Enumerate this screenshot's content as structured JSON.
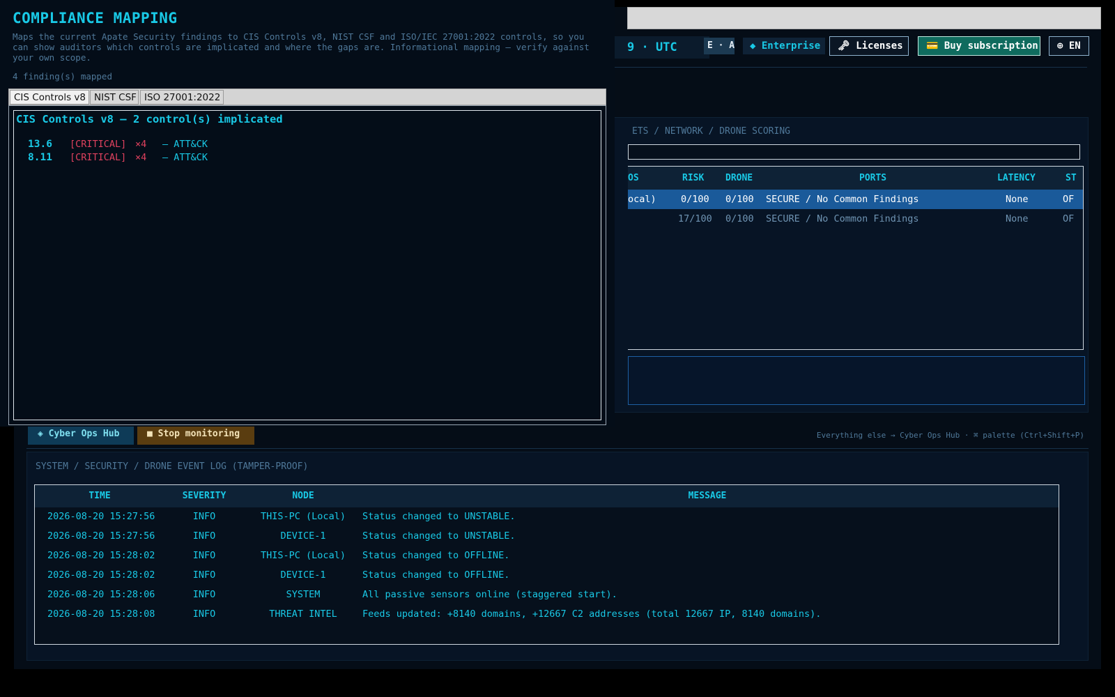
{
  "toolbar": {
    "clock": "9  ·  UTC",
    "mode": "E · AD",
    "edition": "◆ Enterprise",
    "licenses": "🗝 Licenses",
    "buy": "💳 Buy subscription",
    "language": "⊕ EN"
  },
  "assets": {
    "breadcrumb": "ETS / NETWORK / DRONE SCORING",
    "columns": [
      "OS",
      "RISK",
      "DRONE",
      "PORTS",
      "LATENCY",
      "ST"
    ],
    "rows": [
      {
        "name": "ocal)",
        "risk": "0/100",
        "drone": "0/100",
        "ports": "SECURE / No Common Findings",
        "latency": "None",
        "status": "OF"
      },
      {
        "name": "",
        "risk": "17/100",
        "drone": "0/100",
        "ports": "SECURE / No Common Findings",
        "latency": "None",
        "status": "OF"
      }
    ]
  },
  "actions": {
    "hub": "◈  Cyber Ops Hub",
    "stop": "■  Stop monitoring",
    "hint": "Everything else → Cyber Ops Hub  ·  ⌘ palette (Ctrl+Shift+P)"
  },
  "event_log": {
    "title": "SYSTEM / SECURITY / DRONE EVENT LOG (TAMPER-PROOF)",
    "columns": {
      "time": "TIME",
      "severity": "SEVERITY",
      "node": "NODE",
      "message": "MESSAGE"
    },
    "rows": [
      {
        "time": "2026-08-20 15:27:56",
        "severity": "INFO",
        "node": "THIS-PC (Local)",
        "message": "Status changed to UNSTABLE."
      },
      {
        "time": "2026-08-20 15:27:56",
        "severity": "INFO",
        "node": "DEVICE-1",
        "message": "Status changed to UNSTABLE."
      },
      {
        "time": "2026-08-20 15:28:02",
        "severity": "INFO",
        "node": "THIS-PC (Local)",
        "message": "Status changed to OFFLINE."
      },
      {
        "time": "2026-08-20 15:28:02",
        "severity": "INFO",
        "node": "DEVICE-1",
        "message": "Status changed to OFFLINE."
      },
      {
        "time": "2026-08-20 15:28:06",
        "severity": "INFO",
        "node": "SYSTEM",
        "message": "All passive sensors online (staggered start)."
      },
      {
        "time": "2026-08-20 15:28:08",
        "severity": "INFO",
        "node": "THREAT INTEL",
        "message": "Feeds updated: +8140 domains, +12667 C2 addresses (total 12667 IP, 8140 domains)."
      }
    ]
  },
  "compliance": {
    "title": "COMPLIANCE MAPPING",
    "description": "Maps the current Apate Security findings to CIS Controls v8, NIST CSF and ISO/IEC 27001:2022 controls, so you can show auditors which controls are implicated and where the gaps are. Informational mapping — verify against your own scope.",
    "count": "4 finding(s) mapped",
    "tabs": [
      "CIS Controls v8",
      "NIST CSF",
      "ISO 27001:2022"
    ],
    "active_tab": "CIS Controls v8",
    "heading": "CIS Controls v8 — 2 control(s) implicated",
    "controls": [
      {
        "id": "13.6",
        "severity": "[CRITICAL]",
        "count": "×4",
        "source": "— ATT&CK"
      },
      {
        "id": "8.11",
        "severity": "[CRITICAL]",
        "count": "×4",
        "source": "— ATT&CK"
      }
    ]
  },
  "colors": {
    "accent": "#19c9e6",
    "critical": "#e0415e",
    "background": "#050d17",
    "selected_row": "#1a5a9a"
  }
}
